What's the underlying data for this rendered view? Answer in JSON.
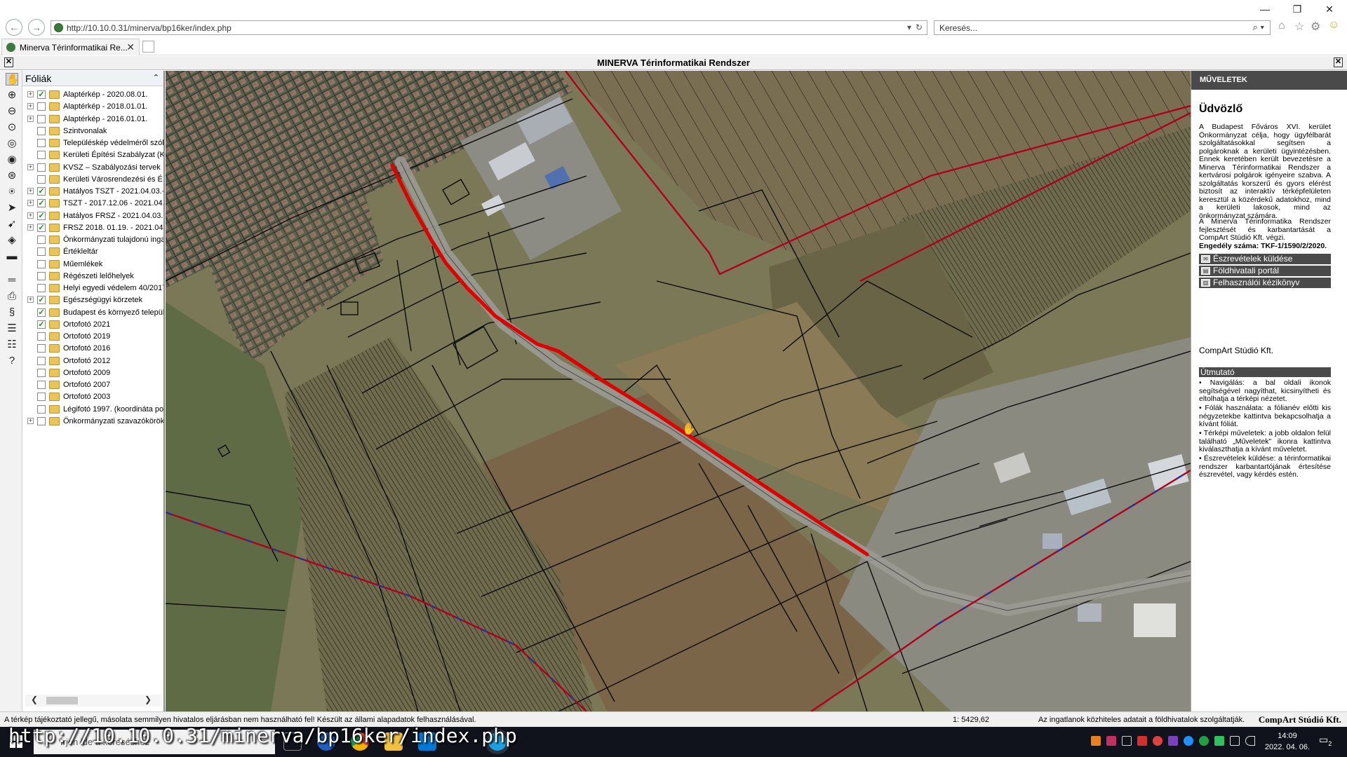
{
  "browser": {
    "url": "http://10.10.0.31/minerva/bp16ker/index.php",
    "search_placeholder": "Keresés...",
    "tab_title": "Minerva Térinformatikai Re..."
  },
  "app": {
    "title": "MINERVA Térinformatikai Rendszer"
  },
  "layers": {
    "title": "Fóliák",
    "items": [
      {
        "label": "Alaptérkép - 2020.08.01.",
        "checked": true,
        "expandable": true
      },
      {
        "label": "Alaptérkép - 2018.01.01.",
        "checked": false,
        "expandable": true
      },
      {
        "label": "Alaptérkép - 2016.01.01.",
        "checked": false,
        "expandable": true
      },
      {
        "label": "Szintvonalak",
        "checked": false,
        "expandable": false
      },
      {
        "label": "Településkép védelméről szól",
        "checked": false,
        "expandable": false
      },
      {
        "label": "Kerületi Építési Szabályzat (K",
        "checked": false,
        "expandable": false
      },
      {
        "label": "KVSZ – Szabályozási tervek",
        "checked": false,
        "expandable": true
      },
      {
        "label": "Kerületi Városrendezési és É",
        "checked": false,
        "expandable": false
      },
      {
        "label": "Hatályos TSZT - 2021.04.03.-",
        "checked": true,
        "expandable": true
      },
      {
        "label": "TSZT - 2017.12.06 - 2021.04.",
        "checked": true,
        "expandable": true
      },
      {
        "label": "Hatályos FRSZ - 2021.04.03.",
        "checked": true,
        "expandable": true
      },
      {
        "label": "FRSZ 2018. 01.19. - 2021.04.",
        "checked": true,
        "expandable": true
      },
      {
        "label": "Önkormányzati tulajdonú inga",
        "checked": false,
        "expandable": false
      },
      {
        "label": "Értékleltár",
        "checked": false,
        "expandable": false
      },
      {
        "label": "Műemlékek",
        "checked": false,
        "expandable": false
      },
      {
        "label": "Régészeti lelőhelyek",
        "checked": false,
        "expandable": false
      },
      {
        "label": "Helyi egyedi védelem 40/2017",
        "checked": false,
        "expandable": false
      },
      {
        "label": "Egészségügyi körzetek",
        "checked": true,
        "expandable": true
      },
      {
        "label": "Budapest és környező települ",
        "checked": true,
        "expandable": false
      },
      {
        "label": "Ortofotó 2021",
        "checked": true,
        "expandable": false
      },
      {
        "label": "Ortofotó 2019",
        "checked": false,
        "expandable": false
      },
      {
        "label": "Ortofotó 2016",
        "checked": false,
        "expandable": false
      },
      {
        "label": "Ortofotó 2012",
        "checked": false,
        "expandable": false
      },
      {
        "label": "Ortofotó 2009",
        "checked": false,
        "expandable": false
      },
      {
        "label": "Ortofotó 2007",
        "checked": false,
        "expandable": false
      },
      {
        "label": "Ortofotó 2003",
        "checked": false,
        "expandable": false
      },
      {
        "label": "Légifotó 1997. (koordináta po",
        "checked": false,
        "expandable": false
      },
      {
        "label": "Önkormányzati szavazókörök",
        "checked": false,
        "expandable": true
      }
    ]
  },
  "ops": {
    "header": "MŰVELETEK",
    "welcome": "Üdvözlő",
    "p1": "A Budapest Főváros XVI. kerület Önkormányzat célja, hogy ügyfélbarát szolgáltatásokkal segítsen a polgároknak a kerületi ügyintézésben. Ennek keretében került bevezetésre a Minerva Térinformatikai Rendszer a kertvárosi polgárok igényeire szabva. A szolgáltatás korszerű és gyors elérést biztosít az interaktív térképfelületen keresztül a közérdekű adatokhoz, mind a kerületi lakosok, mind az önkormányzat számára.",
    "p2": "A Minerva Térinformatika Rendszer fejlesztését és karbantartását a CompArt Stúdió Kft. végzi.",
    "p3": "Engedély száma: TKF-1/1590/2/2020.",
    "btn1": "Észrevételek küldése",
    "btn2": "Földhivatali portál",
    "btn3": "Felhasználói kézikönyv",
    "company": "CompArt Stúdió Kft.",
    "guide_title": "Útmutató",
    "g1": "• Navigálás: a bal oldali ikonok segítségével nagyíthat, kicsinyítheti és eltolhatja a térképi nézetet.",
    "g2": "• Fólák használata: a fólianév előtti kis négyzetekbe kattintva bekapcsolhatja a kívánt fóliát.",
    "g3": "• Térképi műveletek: a jobb oldalon felül található „Műveletek\" ikonra kattintva kiválaszthatja a kívánt műveletet.",
    "g4": "• Észrevételek küldése: a térinformatikai rendszer karbantartójának értesítése észrevétel, vagy kérdés estén."
  },
  "status": {
    "disclaimer": "A térkép tájékoztató jellegű, másolata semmilyen hivatalos eljárásban nem használható fel! Készült az állami alapadatok felhasználásával.",
    "scale": "1: 5429,62",
    "notice": "Az ingatlanok közhiteles adatait a földhivatalok szolgáltatják.",
    "brand": "CompArt Stúdió Kft."
  },
  "taskbar": {
    "search_placeholder": "Írjon ide a kereséshez",
    "time": "14:09",
    "date": "2022. 04. 06.",
    "notif_count": "2"
  },
  "overlay_url": "http://10.10.0.31/minerva/bp16ker/index.php",
  "colors": {
    "route": "#e00000",
    "boundary": "#b00020",
    "panel_dark": "#4a4a4a"
  }
}
